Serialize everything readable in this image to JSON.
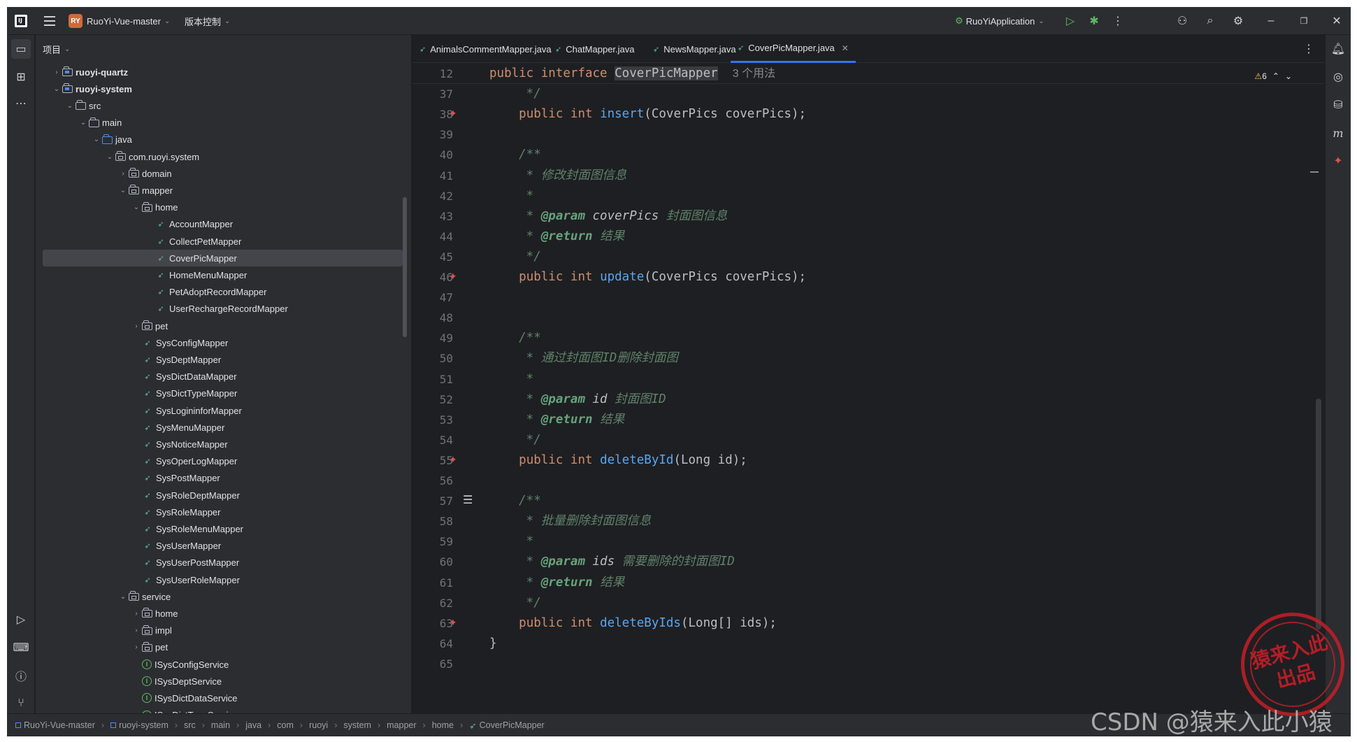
{
  "titlebar": {
    "project_badge": "RY",
    "project_name": "RuoYi-Vue-master",
    "vcs": "版本控制",
    "run_config": "RuoYiApplication"
  },
  "project_panel": {
    "header": "项目",
    "tree": [
      {
        "label": "ruoyi-quartz",
        "level": 0,
        "arrow": "›",
        "icon": "folder-mod",
        "bold": true
      },
      {
        "label": "ruoyi-system",
        "level": 0,
        "arrow": "⌄",
        "icon": "folder-mod",
        "bold": true
      },
      {
        "label": "src",
        "level": 1,
        "arrow": "⌄",
        "icon": "folder"
      },
      {
        "label": "main",
        "level": 2,
        "arrow": "⌄",
        "icon": "folder"
      },
      {
        "label": "java",
        "level": 3,
        "arrow": "⌄",
        "icon": "folder-src"
      },
      {
        "label": "com.ruoyi.system",
        "level": 4,
        "arrow": "⌄",
        "icon": "package"
      },
      {
        "label": "domain",
        "level": 5,
        "arrow": "›",
        "icon": "package"
      },
      {
        "label": "mapper",
        "level": 5,
        "arrow": "⌄",
        "icon": "package"
      },
      {
        "label": "home",
        "level": 6,
        "arrow": "⌄",
        "icon": "package"
      },
      {
        "label": "AccountMapper",
        "level": 7,
        "arrow": "",
        "icon": "mapper"
      },
      {
        "label": "CollectPetMapper",
        "level": 7,
        "arrow": "",
        "icon": "mapper"
      },
      {
        "label": "CoverPicMapper",
        "level": 7,
        "arrow": "",
        "icon": "mapper",
        "selected": true
      },
      {
        "label": "HomeMenuMapper",
        "level": 7,
        "arrow": "",
        "icon": "mapper"
      },
      {
        "label": "PetAdoptRecordMapper",
        "level": 7,
        "arrow": "",
        "icon": "mapper"
      },
      {
        "label": "UserRechargeRecordMapper",
        "level": 7,
        "arrow": "",
        "icon": "mapper"
      },
      {
        "label": "pet",
        "level": 6,
        "arrow": "›",
        "icon": "package"
      },
      {
        "label": "SysConfigMapper",
        "level": 6,
        "arrow": "",
        "icon": "mapper"
      },
      {
        "label": "SysDeptMapper",
        "level": 6,
        "arrow": "",
        "icon": "mapper"
      },
      {
        "label": "SysDictDataMapper",
        "level": 6,
        "arrow": "",
        "icon": "mapper"
      },
      {
        "label": "SysDictTypeMapper",
        "level": 6,
        "arrow": "",
        "icon": "mapper"
      },
      {
        "label": "SysLogininforMapper",
        "level": 6,
        "arrow": "",
        "icon": "mapper"
      },
      {
        "label": "SysMenuMapper",
        "level": 6,
        "arrow": "",
        "icon": "mapper"
      },
      {
        "label": "SysNoticeMapper",
        "level": 6,
        "arrow": "",
        "icon": "mapper"
      },
      {
        "label": "SysOperLogMapper",
        "level": 6,
        "arrow": "",
        "icon": "mapper"
      },
      {
        "label": "SysPostMapper",
        "level": 6,
        "arrow": "",
        "icon": "mapper"
      },
      {
        "label": "SysRoleDeptMapper",
        "level": 6,
        "arrow": "",
        "icon": "mapper"
      },
      {
        "label": "SysRoleMapper",
        "level": 6,
        "arrow": "",
        "icon": "mapper"
      },
      {
        "label": "SysRoleMenuMapper",
        "level": 6,
        "arrow": "",
        "icon": "mapper"
      },
      {
        "label": "SysUserMapper",
        "level": 6,
        "arrow": "",
        "icon": "mapper"
      },
      {
        "label": "SysUserPostMapper",
        "level": 6,
        "arrow": "",
        "icon": "mapper"
      },
      {
        "label": "SysUserRoleMapper",
        "level": 6,
        "arrow": "",
        "icon": "mapper"
      },
      {
        "label": "service",
        "level": 5,
        "arrow": "⌄",
        "icon": "package"
      },
      {
        "label": "home",
        "level": 6,
        "arrow": "›",
        "icon": "package"
      },
      {
        "label": "impl",
        "level": 6,
        "arrow": "›",
        "icon": "package"
      },
      {
        "label": "pet",
        "level": 6,
        "arrow": "›",
        "icon": "package"
      },
      {
        "label": "ISysConfigService",
        "level": 6,
        "arrow": "",
        "icon": "interface"
      },
      {
        "label": "ISysDeptService",
        "level": 6,
        "arrow": "",
        "icon": "interface"
      },
      {
        "label": "ISysDictDataService",
        "level": 6,
        "arrow": "",
        "icon": "interface"
      },
      {
        "label": "ISysDictTypeService",
        "level": 6,
        "arrow": "",
        "icon": "interface"
      }
    ]
  },
  "editor": {
    "tabs": [
      {
        "label": "AnimalsCommentMapper.java",
        "active": false
      },
      {
        "label": "ChatMapper.java",
        "active": false
      },
      {
        "label": "NewsMapper.java",
        "active": false
      },
      {
        "label": "CoverPicMapper.java",
        "active": true
      }
    ],
    "warnings": "6",
    "sticky": {
      "line": "12",
      "kw1": "public",
      "kw2": "interface",
      "name": "CoverPicMapper",
      "hint": "3 个用法"
    },
    "lines": [
      {
        "n": "37",
        "tokens": [
          [
            "cm",
            "     */"
          ]
        ]
      },
      {
        "n": "38",
        "gutter": "mapper",
        "tokens": [
          [
            "",
            "    "
          ],
          [
            "kw",
            "public"
          ],
          [
            "",
            " "
          ],
          [
            "kw",
            "int"
          ],
          [
            "",
            " "
          ],
          [
            "fn",
            "insert"
          ],
          [
            "",
            "(CoverPics coverPics);"
          ]
        ]
      },
      {
        "n": "39",
        "tokens": []
      },
      {
        "n": "40",
        "tokens": [
          [
            "cm",
            "    /**"
          ]
        ]
      },
      {
        "n": "41",
        "tokens": [
          [
            "cm",
            "     * 修改封面图信息"
          ]
        ]
      },
      {
        "n": "42",
        "tokens": [
          [
            "cm",
            "     *"
          ]
        ]
      },
      {
        "n": "43",
        "tokens": [
          [
            "cm",
            "     * "
          ],
          [
            "tag",
            "@param"
          ],
          [
            "pname",
            " coverPics "
          ],
          [
            "cm",
            "封面图信息"
          ]
        ]
      },
      {
        "n": "44",
        "tokens": [
          [
            "cm",
            "     * "
          ],
          [
            "tag",
            "@return"
          ],
          [
            "cm",
            " 结果"
          ]
        ]
      },
      {
        "n": "45",
        "tokens": [
          [
            "cm",
            "     */"
          ]
        ]
      },
      {
        "n": "46",
        "gutter": "mapper",
        "tokens": [
          [
            "",
            "    "
          ],
          [
            "kw",
            "public"
          ],
          [
            "",
            " "
          ],
          [
            "kw",
            "int"
          ],
          [
            "",
            " "
          ],
          [
            "fn",
            "update"
          ],
          [
            "",
            "(CoverPics coverPics);"
          ]
        ]
      },
      {
        "n": "47",
        "tokens": []
      },
      {
        "n": "48",
        "tokens": []
      },
      {
        "n": "49",
        "tokens": [
          [
            "cm",
            "    /**"
          ]
        ]
      },
      {
        "n": "50",
        "tokens": [
          [
            "cm",
            "     * 通过封面图ID删除封面图"
          ]
        ]
      },
      {
        "n": "51",
        "tokens": [
          [
            "cm",
            "     *"
          ]
        ]
      },
      {
        "n": "52",
        "tokens": [
          [
            "cm",
            "     * "
          ],
          [
            "tag",
            "@param"
          ],
          [
            "pname",
            " id "
          ],
          [
            "cm",
            "封面图ID"
          ]
        ]
      },
      {
        "n": "53",
        "tokens": [
          [
            "cm",
            "     * "
          ],
          [
            "tag",
            "@return"
          ],
          [
            "cm",
            " 结果"
          ]
        ]
      },
      {
        "n": "54",
        "tokens": [
          [
            "cm",
            "     */"
          ]
        ]
      },
      {
        "n": "55",
        "gutter": "mapper",
        "tokens": [
          [
            "",
            "    "
          ],
          [
            "kw",
            "public"
          ],
          [
            "",
            " "
          ],
          [
            "kw",
            "int"
          ],
          [
            "",
            " "
          ],
          [
            "fn",
            "deleteById"
          ],
          [
            "",
            "(Long id);"
          ]
        ]
      },
      {
        "n": "56",
        "tokens": []
      },
      {
        "n": "57",
        "gutter": "doc",
        "tokens": [
          [
            "cm",
            "    /**"
          ]
        ]
      },
      {
        "n": "58",
        "tokens": [
          [
            "cm",
            "     * 批量删除封面图信息"
          ]
        ]
      },
      {
        "n": "59",
        "tokens": [
          [
            "cm",
            "     *"
          ]
        ]
      },
      {
        "n": "60",
        "tokens": [
          [
            "cm",
            "     * "
          ],
          [
            "tag",
            "@param"
          ],
          [
            "pname",
            " ids "
          ],
          [
            "cm",
            "需要删除的封面图ID"
          ]
        ]
      },
      {
        "n": "61",
        "tokens": [
          [
            "cm",
            "     * "
          ],
          [
            "tag",
            "@return"
          ],
          [
            "cm",
            " 结果"
          ]
        ]
      },
      {
        "n": "62",
        "tokens": [
          [
            "cm",
            "     */"
          ]
        ]
      },
      {
        "n": "63",
        "gutter": "mapper",
        "tokens": [
          [
            "",
            "    "
          ],
          [
            "kw",
            "public"
          ],
          [
            "",
            " "
          ],
          [
            "kw",
            "int"
          ],
          [
            "",
            " "
          ],
          [
            "fn",
            "deleteByIds"
          ],
          [
            "",
            "(Long[] ids);"
          ]
        ]
      },
      {
        "n": "64",
        "tokens": [
          [
            "",
            "}"
          ]
        ]
      },
      {
        "n": "65",
        "tokens": []
      }
    ]
  },
  "statusbar": {
    "breadcrumb": [
      "RuoYi-Vue-master",
      "ruoyi-system",
      "src",
      "main",
      "java",
      "com",
      "ruoyi",
      "system",
      "mapper",
      "home",
      "CoverPicMapper"
    ]
  },
  "watermark": {
    "text": "CSDN @猿来入此小猿",
    "stamp_line1": "猿来入此",
    "stamp_line2": "出品"
  },
  "colors": {
    "accent": "#3574f0",
    "keyword": "#cf8e6d",
    "function": "#56a8f5",
    "comment": "#5f826b",
    "background": "#1e1f22",
    "panel": "#2b2d30"
  }
}
